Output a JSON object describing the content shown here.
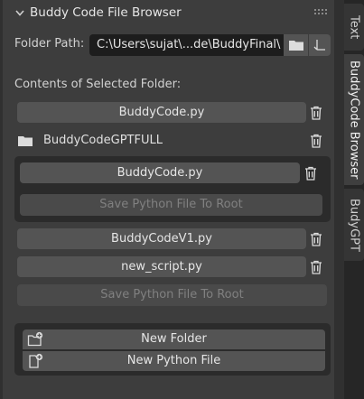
{
  "panel": {
    "title": "Buddy Code File Browser",
    "folder_path_label": "Folder Path:",
    "folder_path_value": "C:\\Users\\sujat\\...de\\BuddyFinal\\",
    "contents_label": "Contents of Selected Folder:"
  },
  "items": {
    "file1": "BuddyCode.py",
    "folder1": "BuddyCodeGPTFULL",
    "folder1_file": "BuddyCode.py",
    "folder1_save": "Save Python File To Root",
    "file2": "BuddyCodeV1.py",
    "file3": "new_script.py",
    "save_root": "Save Python File To Root"
  },
  "actions": {
    "new_folder": "New Folder",
    "new_python_file": "New Python File"
  },
  "tabs": [
    "Text",
    "BuddyCode Browser",
    "BudyGPT"
  ],
  "colors": {
    "panel_bg": "#3d3d3d",
    "button_bg": "#545454",
    "field_bg": "#1d1d1d",
    "subbox_bg": "#2b2b2b",
    "disabled_text": "#808080"
  }
}
